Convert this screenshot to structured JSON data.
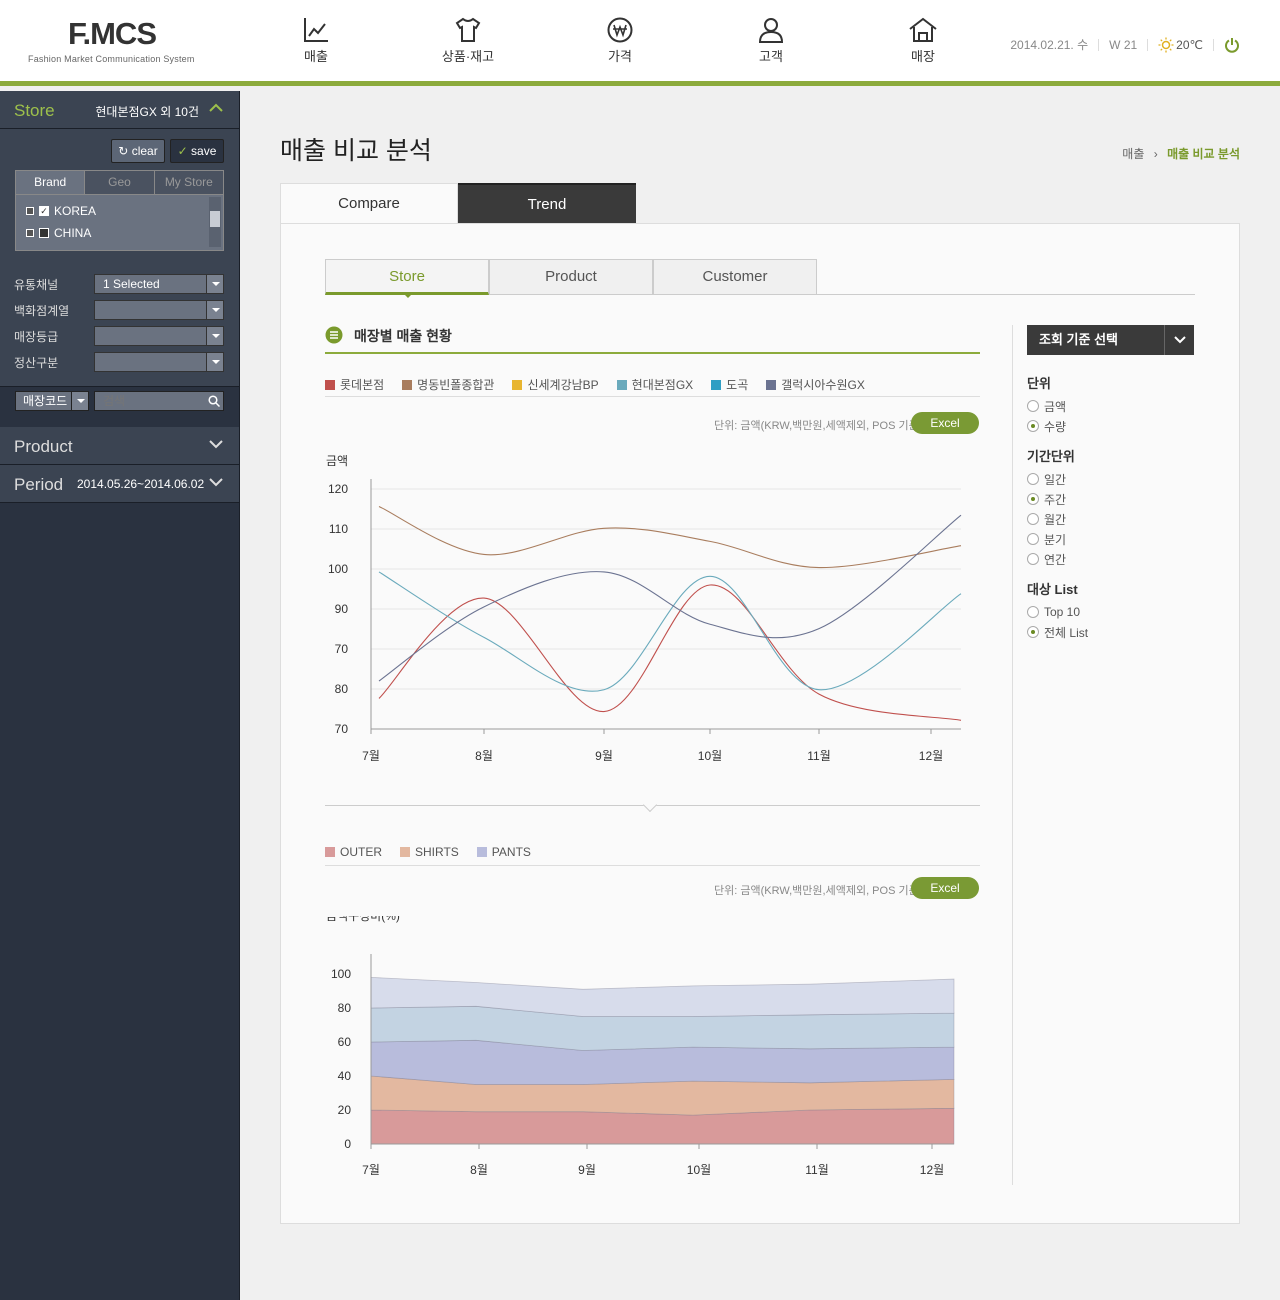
{
  "header": {
    "logo": "F.MCS",
    "logo_sub": "Fashion Market Communication System",
    "nav": [
      {
        "label": "매출"
      },
      {
        "label": "상품·재고"
      },
      {
        "label": "가격"
      },
      {
        "label": "고객"
      },
      {
        "label": "매장"
      }
    ],
    "date": "2014.02.21. 수",
    "week": "W 21",
    "temp": "20℃"
  },
  "sidebar": {
    "store": {
      "title": "Store",
      "selected": "현대본점GX 외 10건"
    },
    "clear_label": "clear",
    "save_label": "save",
    "tabs": [
      "Brand",
      "Geo",
      "My Store"
    ],
    "countries": [
      {
        "label": "KOREA",
        "checked": true
      },
      {
        "label": "CHINA",
        "checked": false
      }
    ],
    "filters": [
      {
        "label": "유통채널",
        "value": "1 Selected"
      },
      {
        "label": "백화점계열",
        "value": ""
      },
      {
        "label": "매장등급",
        "value": ""
      },
      {
        "label": "정산구분",
        "value": ""
      }
    ],
    "code_select": "매장코드",
    "search_placeholder": "검색",
    "product": "Product",
    "period": {
      "title": "Period",
      "value": "2014.05.26~2014.06.02"
    }
  },
  "main": {
    "title": "매출 비교 분석",
    "breadcrumb": {
      "parent": "매출",
      "current": "매출 비교 분석"
    },
    "top_tabs": [
      "Compare",
      "Trend"
    ],
    "sub_tabs": [
      "Store",
      "Product",
      "Customer"
    ],
    "section_title": "매장별 매출 현황",
    "unit_note": "단위: 금액(KRW,백만원,세액제외, POS 기준)",
    "excel_label": "Excel"
  },
  "right": {
    "select_label": "조회 기준 선택",
    "unit_title": "단위",
    "unit_options": [
      {
        "label": "금액",
        "on": false
      },
      {
        "label": "수량",
        "on": true
      }
    ],
    "period_title": "기간단위",
    "period_options": [
      {
        "label": "일간",
        "on": false
      },
      {
        "label": "주간",
        "on": true
      },
      {
        "label": "월간",
        "on": false
      },
      {
        "label": "분기",
        "on": false
      },
      {
        "label": "연간",
        "on": false
      }
    ],
    "target_title": "대상 List",
    "target_options": [
      {
        "label": "Top 10",
        "on": false
      },
      {
        "label": "전체 List",
        "on": true
      }
    ]
  },
  "chart_data": [
    {
      "type": "line",
      "ylabel": "금액",
      "categories": [
        "7월",
        "8월",
        "9월",
        "10월",
        "11월",
        "12월"
      ],
      "y_ticks": [
        "120",
        "110",
        "100",
        "90",
        "70",
        "80",
        "70"
      ],
      "series": [
        {
          "name": "롯데본점",
          "color": "#c0504d",
          "values": [
            72,
            95,
            69,
            98,
            73,
            67
          ]
        },
        {
          "name": "명동빈폴종합관",
          "color": "#a97d5e",
          "values": [
            116,
            105,
            111,
            108,
            102,
            107
          ]
        },
        {
          "name": "신세계강남BP",
          "color": "#e8b530",
          "values": []
        },
        {
          "name": "현대본점GX",
          "color": "#6aaabc",
          "values": [
            101,
            86,
            74,
            100,
            74,
            96
          ]
        },
        {
          "name": "도곡",
          "color": "#2f9ec4",
          "values": []
        },
        {
          "name": "갤럭시아수원GX",
          "color": "#6b7391",
          "values": [
            76,
            93,
            101,
            89,
            88,
            114
          ]
        }
      ]
    },
    {
      "type": "area",
      "ylabel": "금액구성비(%)",
      "categories": [
        "7월",
        "8월",
        "9월",
        "10월",
        "11월",
        "12월"
      ],
      "ylim": [
        0,
        100
      ],
      "y_ticks": [
        "100",
        "80",
        "60",
        "40",
        "20",
        "0"
      ],
      "series": [
        {
          "name": "OUTER",
          "color": "#d89a9a",
          "values": [
            20,
            19,
            19,
            17,
            20,
            21
          ]
        },
        {
          "name": "SHIRTS",
          "color": "#e3b8a0",
          "values": [
            20,
            16,
            16,
            20,
            16,
            17
          ]
        },
        {
          "name": "PANTS",
          "color": "#b8bcdc",
          "values": [
            20,
            26,
            20,
            20,
            20,
            19
          ]
        },
        {
          "name": "",
          "color": "#c3d3e2",
          "values": [
            20,
            20,
            20,
            18,
            20,
            20
          ]
        },
        {
          "name": "",
          "color": "#d7dceb",
          "values": [
            18,
            14,
            16,
            18,
            18,
            20
          ]
        }
      ]
    }
  ]
}
